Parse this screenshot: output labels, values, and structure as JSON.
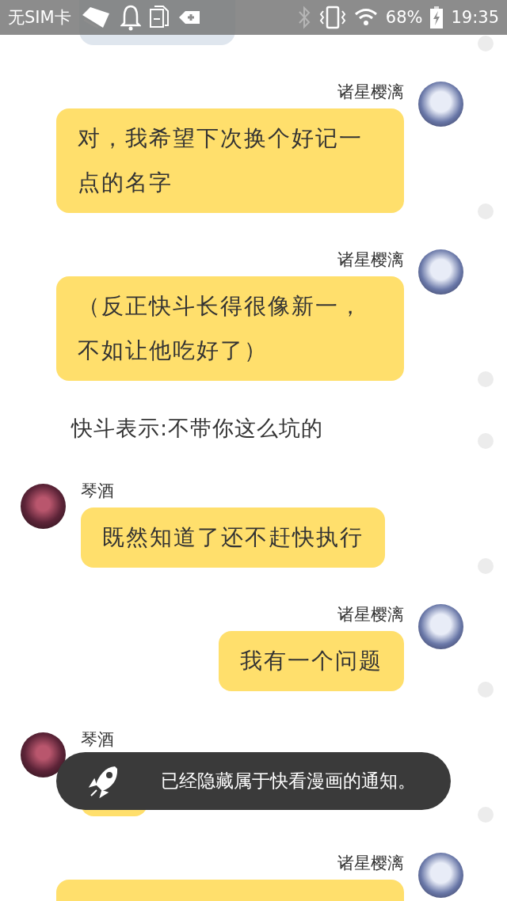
{
  "status_bar": {
    "carrier": "无SIM卡",
    "battery": "68%",
    "time": "19:35"
  },
  "messages": [
    {
      "kind": "fragment"
    },
    {
      "kind": "outgoing",
      "sender": "诸星樱漓",
      "text": "对，我希望下次换个好记一点的名字"
    },
    {
      "kind": "outgoing",
      "sender": "诸星樱漓",
      "text": "（反正快斗长得很像新一，不如让他吃好了）"
    },
    {
      "kind": "narration",
      "text": "快斗表示:不带你这么坑的"
    },
    {
      "kind": "incoming",
      "sender": "琴酒",
      "text": "既然知道了还不赶快执行"
    },
    {
      "kind": "outgoing",
      "sender": "诸星樱漓",
      "text": "我有一个问题"
    },
    {
      "kind": "incoming",
      "sender": "琴酒"
    },
    {
      "kind": "outgoing",
      "sender": "诸星樱漓"
    }
  ],
  "toast": {
    "text": "已经隐藏属于快看漫画的通知。"
  }
}
